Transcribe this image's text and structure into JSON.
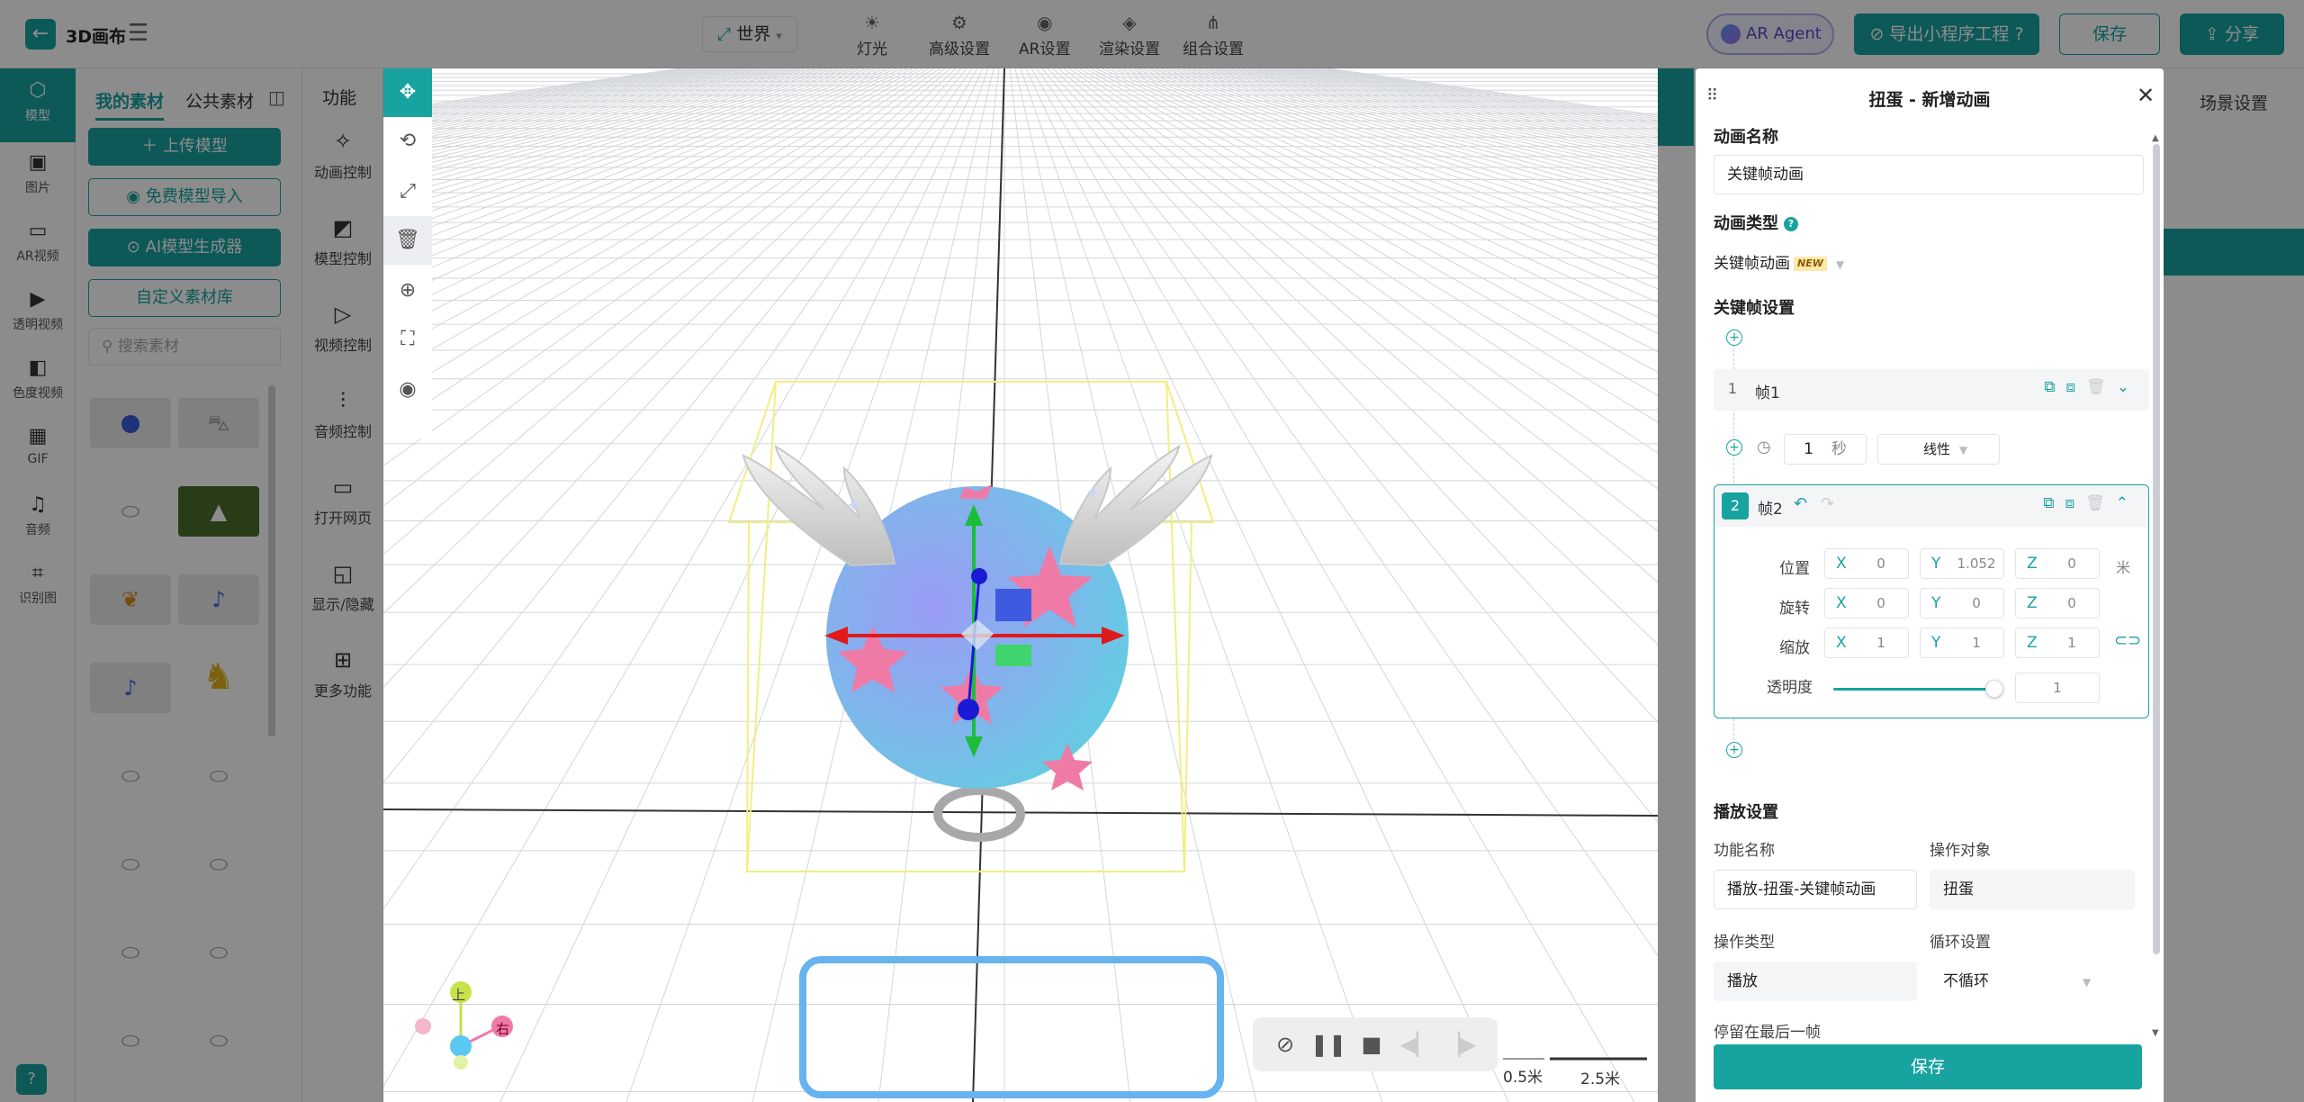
{
  "app": {
    "title": "3D画布"
  },
  "topbar": {
    "world_label": "世界",
    "tools": [
      "灯光",
      "高级设置",
      "AR设置",
      "渲染设置",
      "组合设置"
    ],
    "ar_agent": "AR Agent",
    "export": "导出小程序工程",
    "save": "保存",
    "share": "分享"
  },
  "rail": {
    "items": [
      "模型",
      "图片",
      "AR视频",
      "透明视频",
      "色度视频",
      "GIF",
      "音频",
      "识别图"
    ]
  },
  "assets": {
    "tabs": [
      "我的素材",
      "公共素材"
    ],
    "buttons": [
      "上传模型",
      "免费模型导入",
      "AI模型生成器",
      "自定义素材库"
    ],
    "search_placeholder": "搜索素材"
  },
  "func": {
    "title": "功能",
    "items": [
      "动画控制",
      "模型控制",
      "视频控制",
      "音频控制",
      "打开网页",
      "显示/隐藏",
      "更多功能"
    ]
  },
  "right_bg": {
    "scene_settings": "场景设置"
  },
  "viewport": {
    "scale": [
      "0.5米",
      "2.5米"
    ],
    "gizmo": {
      "up": "上",
      "right": "右"
    }
  },
  "dialog": {
    "title": "扭蛋 - 新增动画",
    "name_label": "动画名称",
    "name_value": "关键帧动画",
    "type_label": "动画类型",
    "type_value": "关键帧动画",
    "type_badge": "NEW",
    "keyframe_label": "关键帧设置",
    "frame1": {
      "num": "1",
      "name": "帧1"
    },
    "duration": {
      "value": "1",
      "unit": "秒",
      "easing": "线性"
    },
    "frame2": {
      "num": "2",
      "name": "帧2",
      "rows": [
        {
          "label": "位置",
          "x": "0",
          "y": "1.052",
          "z": "0",
          "unit": "米"
        },
        {
          "label": "旋转",
          "x": "0",
          "y": "0",
          "z": "0"
        },
        {
          "label": "缩放",
          "x": "1",
          "y": "1",
          "z": "1"
        }
      ],
      "opacity_label": "透明度",
      "opacity_value": "1",
      "opacity_level": 0.95
    },
    "play_label": "播放设置",
    "func_name_label": "功能名称",
    "func_name_value": "播放-扭蛋-关键帧动画",
    "target_label": "操作对象",
    "target_value": "扭蛋",
    "op_type_label": "操作类型",
    "op_type_value": "播放",
    "loop_label": "循环设置",
    "loop_value": "不循环",
    "stay_label": "停留在最后一帧",
    "save": "保存"
  }
}
